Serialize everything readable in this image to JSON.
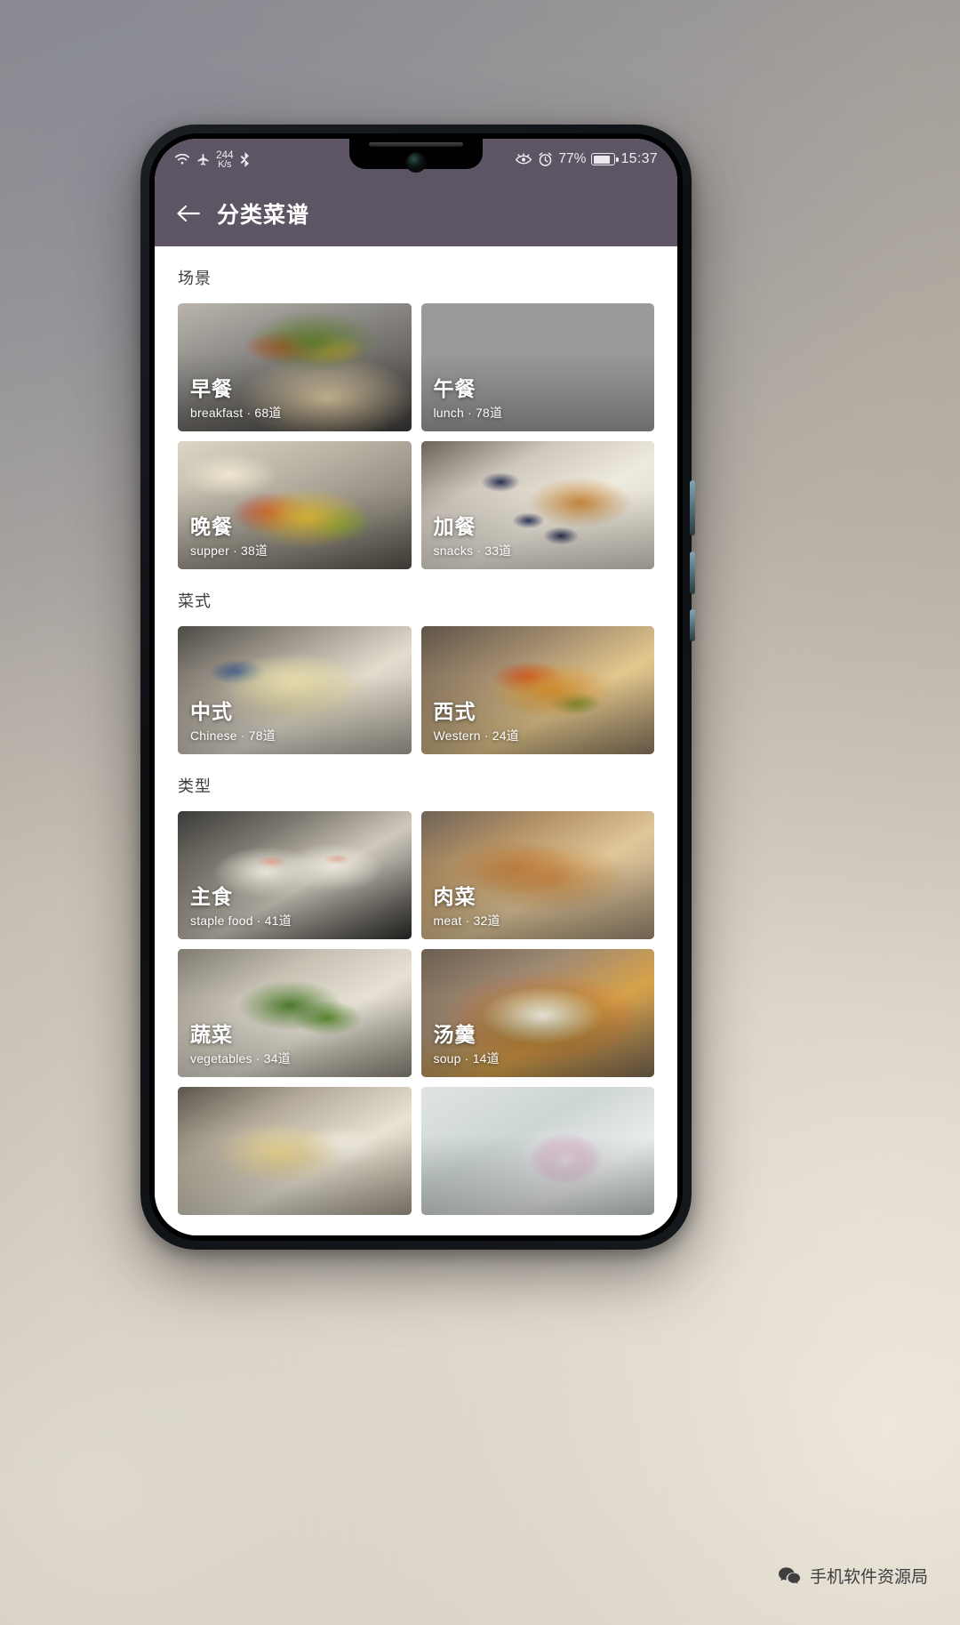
{
  "statusbar": {
    "net_speed_value": "244",
    "net_speed_unit": "K/s",
    "battery_percent": "77%",
    "clock": "15:37",
    "icons": [
      "wifi-icon",
      "airplane-mode-icon",
      "bluetooth-icon",
      "eye-comfort-icon",
      "alarm-icon",
      "battery-icon"
    ]
  },
  "appbar": {
    "back_label": "←",
    "title": "分类菜谱"
  },
  "sections": [
    {
      "title": "场景",
      "cards": [
        {
          "cn": "早餐",
          "sub": "breakfast · 68道",
          "photo": "p-breakfast"
        },
        {
          "cn": "午餐",
          "sub": "lunch · 78道",
          "photo": "p-lunch"
        },
        {
          "cn": "晚餐",
          "sub": "supper · 38道",
          "photo": "p-supper"
        },
        {
          "cn": "加餐",
          "sub": "snacks · 33道",
          "photo": "p-snacks"
        }
      ]
    },
    {
      "title": "菜式",
      "cards": [
        {
          "cn": "中式",
          "sub": "Chinese · 78道",
          "photo": "p-chinese"
        },
        {
          "cn": "西式",
          "sub": "Western · 24道",
          "photo": "p-western"
        }
      ]
    },
    {
      "title": "类型",
      "cards": [
        {
          "cn": "主食",
          "sub": "staple food · 41道",
          "photo": "p-staple"
        },
        {
          "cn": "肉菜",
          "sub": "meat · 32道",
          "photo": "p-meat"
        },
        {
          "cn": "蔬菜",
          "sub": "vegetables · 34道",
          "photo": "p-veg"
        },
        {
          "cn": "汤羹",
          "sub": "soup · 14道",
          "photo": "p-soup"
        },
        {
          "cn": "",
          "sub": "",
          "photo": "p-row5a"
        },
        {
          "cn": "",
          "sub": "",
          "photo": "p-row5b"
        }
      ]
    }
  ],
  "watermark": {
    "text": "手机软件资源局"
  },
  "colors": {
    "appbar": "#5d5464",
    "statusbar": "#5d5464",
    "page_bg": "#ffffff",
    "section_text": "#3c3c3c"
  }
}
